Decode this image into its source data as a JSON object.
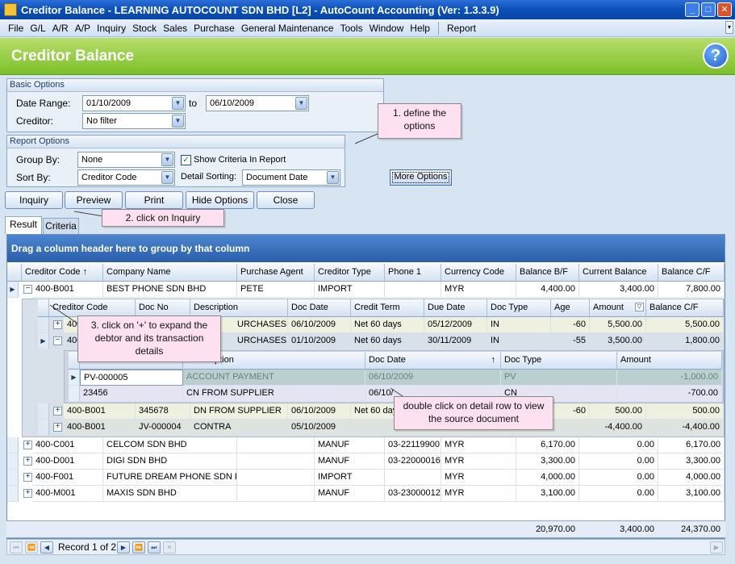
{
  "window": {
    "title": "Creditor Balance - LEARNING AUTOCOUNT SDN BHD [L2] - AutoCount Accounting (Ver: 1.3.3.9)"
  },
  "menu": [
    "File",
    "G/L",
    "A/R",
    "A/P",
    "Inquiry",
    "Stock",
    "Sales",
    "Purchase",
    "General Maintenance",
    "Tools",
    "Window",
    "Help",
    "Report"
  ],
  "header": {
    "title": "Creditor Balance"
  },
  "basic_options": {
    "title": "Basic Options",
    "date_range_label": "Date Range:",
    "date_from": "01/10/2009",
    "to_label": "to",
    "date_to": "06/10/2009",
    "creditor_label": "Creditor:",
    "creditor_value": "No filter"
  },
  "report_options": {
    "title": "Report Options",
    "group_by_label": "Group By:",
    "group_by_value": "None",
    "show_criteria_label": "Show Criteria In Report",
    "sort_by_label": "Sort By:",
    "sort_by_value": "Creditor Code",
    "detail_sorting_label": "Detail Sorting:",
    "detail_sorting_value": "Document Date"
  },
  "buttons": {
    "more_options": "More Options",
    "inquiry": "Inquiry",
    "preview": "Preview",
    "print": "Print",
    "hide_options": "Hide Options",
    "close": "Close"
  },
  "tabs": [
    "Result",
    "Criteria"
  ],
  "callouts": {
    "define": "1. define the options",
    "inquiry": "2. click on Inquiry",
    "expand": "3. click on '+' to expand the debtor and its transaction details",
    "dblclick": "double click on detail row to view the source document"
  },
  "grid": {
    "group_hint": "Drag a column header here to group by that column",
    "columns": [
      "Creditor Code",
      "Company Name",
      "Purchase Agent",
      "Creditor Type",
      "Phone 1",
      "Currency Code",
      "Balance B/F",
      "Current Balance",
      "Balance C/F"
    ],
    "rows": [
      {
        "code": "400-B001",
        "name": "BEST PHONE SDN BHD",
        "agent": "PETE",
        "type": "IMPORT",
        "phone": "",
        "currency": "MYR",
        "bf": "4,400.00",
        "current": "3,400.00",
        "cf": "7,800.00"
      },
      {
        "code": "400-C001",
        "name": "CELCOM SDN BHD",
        "agent": "",
        "type": "MANUF",
        "phone": "03-22119900",
        "currency": "MYR",
        "bf": "6,170.00",
        "current": "0.00",
        "cf": "6,170.00"
      },
      {
        "code": "400-D001",
        "name": "DIGI SDN BHD",
        "agent": "",
        "type": "MANUF",
        "phone": "03-22000016",
        "currency": "MYR",
        "bf": "3,300.00",
        "current": "0.00",
        "cf": "3,300.00"
      },
      {
        "code": "400-F001",
        "name": "FUTURE DREAM PHONE SDN BHD",
        "agent": "",
        "type": "IMPORT",
        "phone": "",
        "currency": "MYR",
        "bf": "4,000.00",
        "current": "0.00",
        "cf": "4,000.00"
      },
      {
        "code": "400-M001",
        "name": "MAXIS SDN BHD",
        "agent": "",
        "type": "MANUF",
        "phone": "03-23000012",
        "currency": "MYR",
        "bf": "3,100.00",
        "current": "0.00",
        "cf": "3,100.00"
      }
    ],
    "detail_columns": [
      "Creditor Code",
      "Doc No",
      "Description",
      "Doc Date",
      "Credit Term",
      "Due Date",
      "Doc Type",
      "Age",
      "Amount",
      "Balance C/F"
    ],
    "detail_rows": [
      {
        "code": "400",
        "docno": "",
        "desc": "URCHASES",
        "date": "06/10/2009",
        "term": "Net 60 days",
        "due": "05/12/2009",
        "type": "IN",
        "age": "-60",
        "amount": "5,500.00",
        "cf": "5,500.00"
      },
      {
        "code": "400",
        "docno": "",
        "desc": "URCHASES",
        "date": "01/10/2009",
        "term": "Net 60 days",
        "due": "30/11/2009",
        "type": "IN",
        "age": "-55",
        "amount": "3,500.00",
        "cf": "1,800.00"
      },
      {
        "code": "400-B001",
        "docno": "345678",
        "desc": "DN FROM SUPPLIER",
        "date": "06/10/2009",
        "term": "Net 60 days",
        "due": "",
        "type": "",
        "age": "-60",
        "amount": "500.00",
        "cf": "500.00"
      },
      {
        "code": "400-B001",
        "docno": "JV-000004",
        "desc": "CONTRA",
        "date": "05/10/2009",
        "term": "",
        "due": "",
        "type": "",
        "age": "",
        "amount": "-4,400.00",
        "cf": "-4,400.00"
      }
    ],
    "sub_columns": [
      "ption",
      "Doc Date",
      "Doc Type",
      "Amount"
    ],
    "sub_rows": [
      {
        "docno": "PV-000005",
        "desc": "ACCOUNT PAYMENT",
        "date": "06/10/2009",
        "type": "PV",
        "amount": "-1,000.00"
      },
      {
        "docno": "23456",
        "desc": "CN FROM SUPPLIER",
        "date": "06/10/",
        "type": "CN",
        "amount": "-700.00"
      }
    ],
    "totals": {
      "bf": "20,970.00",
      "current": "3,400.00",
      "cf": "24,370.00"
    },
    "record_text": "Record 1 of 2"
  }
}
